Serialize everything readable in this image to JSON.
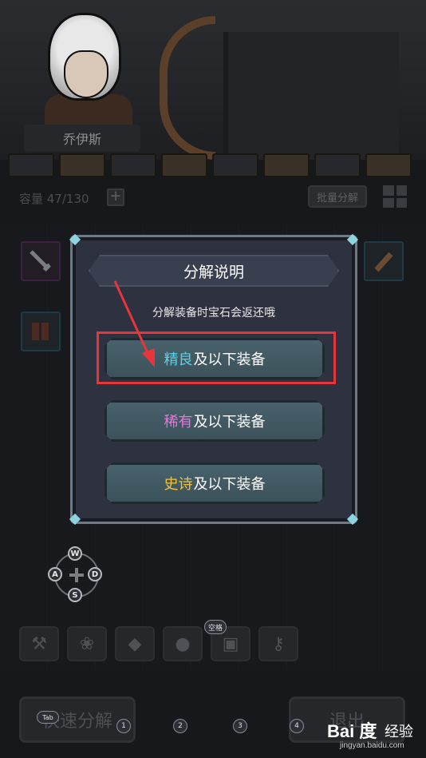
{
  "hero": {
    "name": "乔伊斯"
  },
  "inventory": {
    "capacity_label": "容量 47/130",
    "add_symbol": "+",
    "batch_label": "批量分解"
  },
  "dialog": {
    "title": "分解说明",
    "subtitle": "分解装备时宝石会返还哦",
    "options": [
      {
        "quality": "精良",
        "quality_color": "#5ad1e6",
        "rest": "及以下装备",
        "highlighted": true
      },
      {
        "quality": "稀有",
        "quality_color": "#e07ad8",
        "rest": "及以下装备",
        "highlighted": false
      },
      {
        "quality": "史诗",
        "quality_color": "#f2c23a",
        "rest": "及以下装备",
        "highlighted": false
      }
    ]
  },
  "dpad": {
    "up": "W",
    "left": "A",
    "right": "D",
    "down": "S"
  },
  "toolbar": {
    "space_hint": "空格"
  },
  "bottom": {
    "quick_decompose": "快速分解",
    "exit": "退出",
    "tab_hint": "Tab",
    "hotkeys": [
      "1",
      "2",
      "3",
      "4"
    ]
  },
  "watermark": {
    "logo": "Bai 度",
    "brand_cn": "经验",
    "url": "jingyan.baidu.com"
  },
  "colors": {
    "highlight_box": "#e8353a",
    "arrow": "#e8353a"
  }
}
